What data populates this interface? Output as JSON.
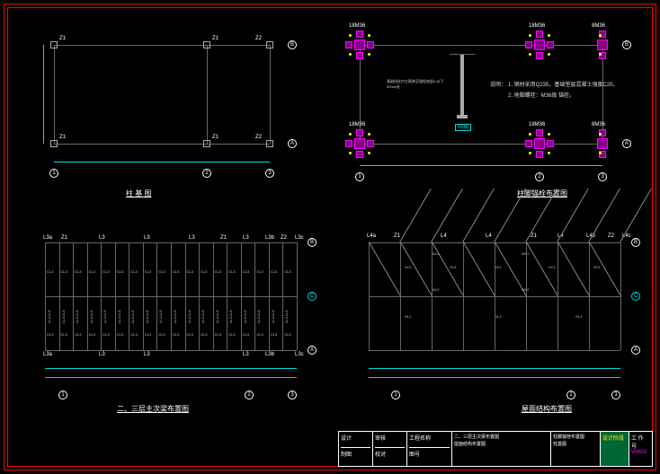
{
  "titleblock": {
    "col1_top": "设计",
    "col1_bot": "制图",
    "col2_top": "审核",
    "col2_bot": "校对",
    "name_label": "工程名称",
    "drawing1": "二、三层主次梁布置图",
    "drawing2": "柱脚锚栓布置图",
    "drawing3": "屋面结构布置图",
    "drawing4": "柱基图",
    "no_label": "图号",
    "stage": "设计阶段",
    "page_label": "工 作 号",
    "page_value": "WI602"
  },
  "panel_A": {
    "title": "柱 基 图",
    "grid_cols": [
      "1",
      "2",
      "3"
    ],
    "grid_rows": [
      "A",
      "B"
    ],
    "col_labels": [
      "Z1",
      "Z1",
      "Z2",
      "Z1",
      "Z1",
      "Z2"
    ]
  },
  "panel_B": {
    "title": "柱脚锚栓布置图",
    "grid_cols": [
      "1",
      "2",
      "3"
    ],
    "grid_rows": [
      "A",
      "B"
    ],
    "bolt_label_18": "18M36",
    "bolt_label_8": "8M36",
    "anchor_tag": "M36",
    "notes_header": "说明：",
    "note1": "1. 钢材采用Q235，基础垫层混凝土强度C20。",
    "note2": "2. 地脚螺栓：M36级 锚栓。",
    "anchor_note_small": "基础短柱内主筋伸至锚栓底部\\n以下50mm处"
  },
  "panel_C": {
    "title": "二、三层主次梁布置图",
    "grid_cols": [
      "1",
      "2",
      "3"
    ],
    "grid_rows": [
      "A",
      "B"
    ],
    "edge_beams": [
      "L3a",
      "Z1",
      "L3",
      "L3",
      "L3",
      "Z1",
      "L3",
      "L3b",
      "Z2",
      "L3c"
    ],
    "sec_label": "CL3",
    "sec_label2": "LL3"
  },
  "panel_D": {
    "title": "屋面结构布置图",
    "grid_cols": [
      "1",
      "2",
      "3"
    ],
    "grid_rows": [
      "A",
      "B"
    ],
    "beams_top": [
      "L4a",
      "Z1",
      "L4",
      "L4",
      "Z1",
      "L4",
      "L4b",
      "Z2",
      "L4c"
    ],
    "brace_label": "XC1",
    "tie_label": "GL1",
    "horz_label": "WL1",
    "horz_label2": "WL2"
  }
}
